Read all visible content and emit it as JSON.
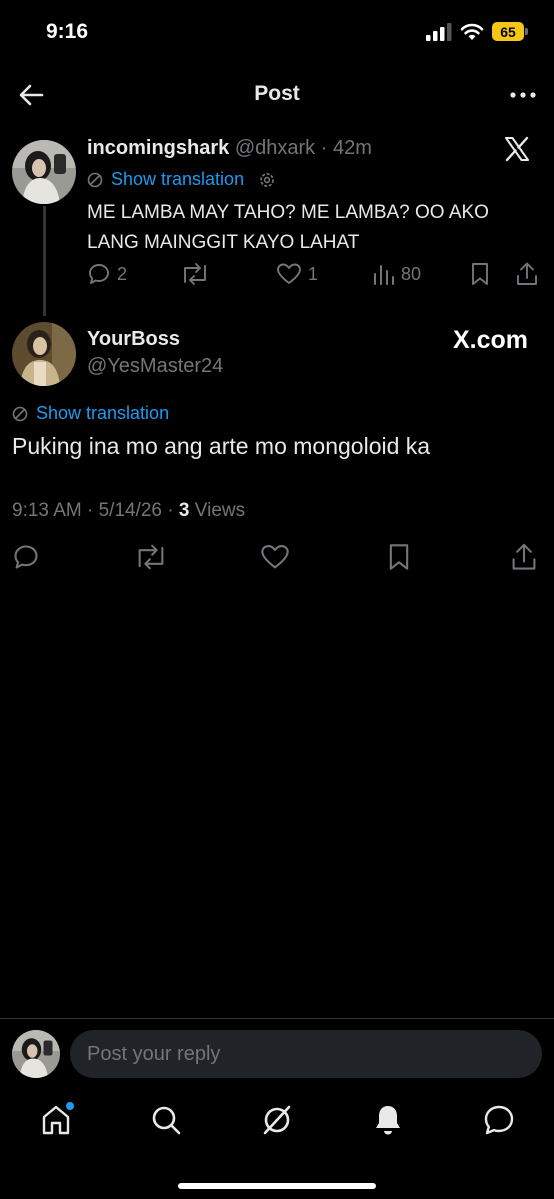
{
  "status_bar": {
    "time": "9:16",
    "battery": "65"
  },
  "header": {
    "title": "Post"
  },
  "quoted_tweet": {
    "display_name": "incomingshark",
    "handle": "@dhxark",
    "separator": "·",
    "time_ago": "42m",
    "translation_label": "Show translation",
    "text": "ME LAMBA MAY TAHO? ME LAMBA? OO AKO LANG MAINGGIT KAYO LAHAT",
    "replies": "2",
    "likes": "1",
    "views": "80"
  },
  "main_tweet": {
    "display_name": "YourBoss",
    "handle": "@YesMaster24",
    "watermark": "X.com",
    "translation_label": "Show translation",
    "text": "Puking ina mo ang arte mo mongoloid ka",
    "time": "9:13 AM",
    "date": "5/14/26",
    "separator": "·",
    "views_count": "3",
    "views_label": "Views"
  },
  "reply": {
    "placeholder": "Post your reply"
  },
  "colors": {
    "accent": "#1d9bf0",
    "background": "#000000",
    "muted": "#71767b",
    "battery": "#f5c518"
  },
  "icons": [
    "back-arrow-icon",
    "more-icon",
    "x-logo-icon",
    "translate-icon",
    "settings-icon",
    "reply-icon",
    "repost-icon",
    "like-icon",
    "views-icon",
    "bookmark-icon",
    "share-icon",
    "home-icon",
    "search-icon",
    "grok-icon",
    "notifications-icon",
    "messages-icon"
  ]
}
